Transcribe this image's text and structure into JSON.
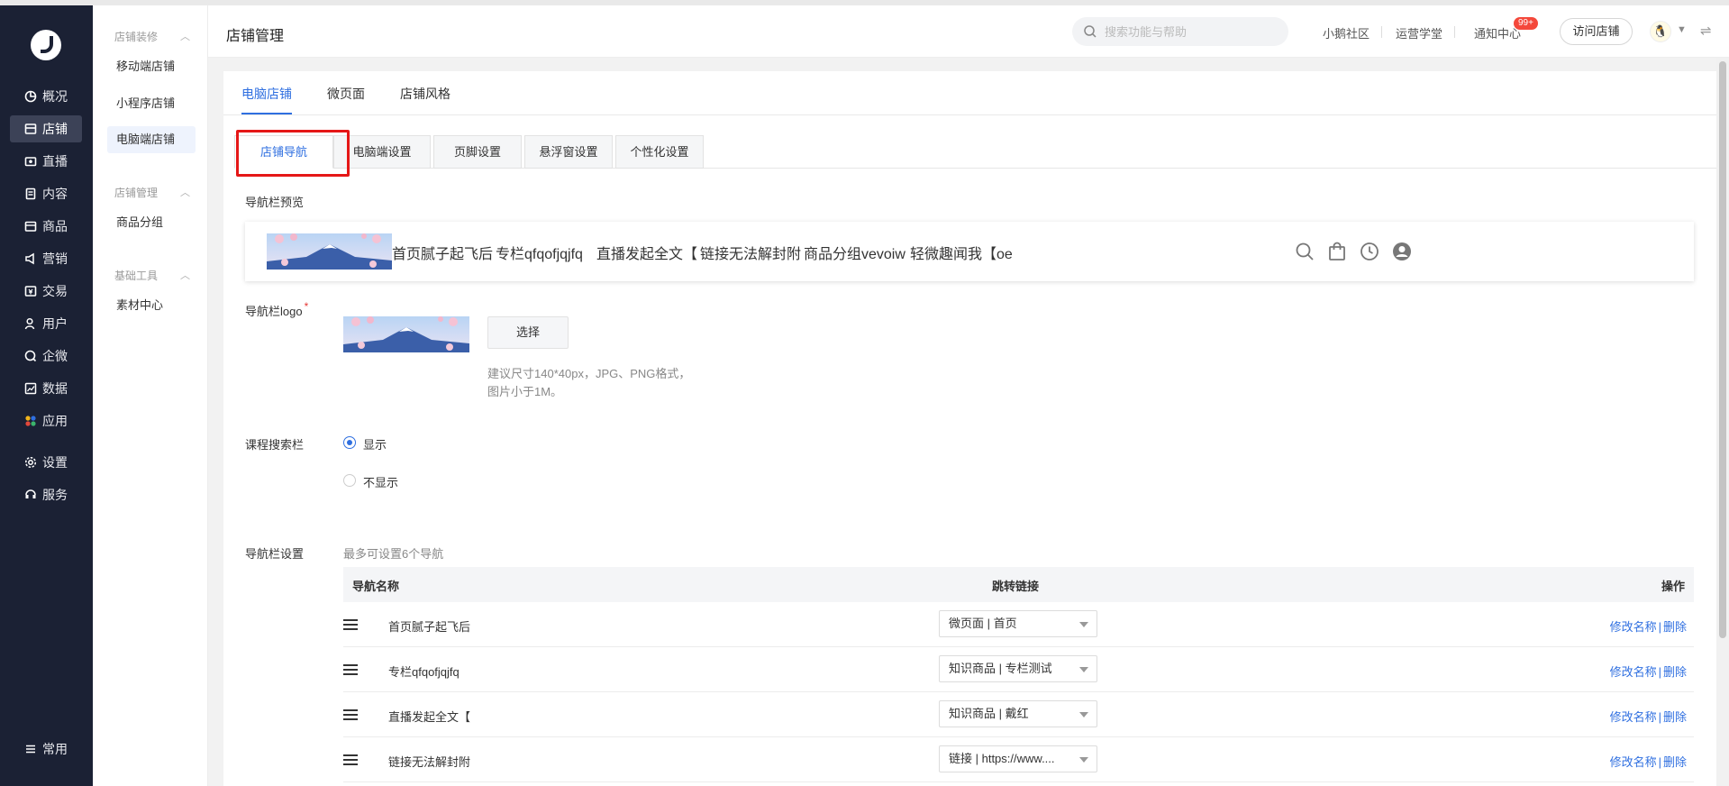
{
  "left_nav": {
    "items": [
      {
        "label": "概况",
        "icon": "pie-chart-icon"
      },
      {
        "label": "店铺",
        "icon": "store-icon",
        "active": true
      },
      {
        "label": "直播",
        "icon": "live-icon"
      },
      {
        "label": "内容",
        "icon": "document-icon"
      },
      {
        "label": "商品",
        "icon": "box-icon"
      },
      {
        "label": "营销",
        "icon": "megaphone-icon"
      },
      {
        "label": "交易",
        "icon": "wallet-icon"
      },
      {
        "label": "用户",
        "icon": "user-icon"
      },
      {
        "label": "企微",
        "icon": "chat-icon"
      },
      {
        "label": "数据",
        "icon": "chart-icon"
      },
      {
        "label": "应用",
        "icon": "apps-icon"
      },
      {
        "label": "设置",
        "icon": "gear-icon"
      },
      {
        "label": "服务",
        "icon": "service-icon"
      }
    ],
    "bottom": {
      "label": "常用",
      "icon": "list-icon"
    }
  },
  "sub_nav": {
    "groups": [
      {
        "title": "店铺装修",
        "items": [
          "移动端店铺",
          "小程序店铺",
          "电脑端店铺"
        ],
        "active": "电脑端店铺"
      },
      {
        "title": "店铺管理",
        "items": [
          "商品分组"
        ]
      },
      {
        "title": "基础工具",
        "items": [
          "素材中心"
        ]
      }
    ]
  },
  "header": {
    "title": "店铺管理",
    "search_placeholder": "搜索功能与帮助",
    "links": [
      "小鹅社区",
      "运营学堂",
      "通知中心"
    ],
    "badge": "99+",
    "visit_button": "访问店铺"
  },
  "tabs": [
    "电脑店铺",
    "微页面",
    "店铺风格"
  ],
  "sub_tabs": [
    "店铺导航",
    "电脑端设置",
    "页脚设置",
    "悬浮窗设置",
    "个性化设置"
  ],
  "form": {
    "preview_label": "导航栏预览",
    "preview_nav": [
      "首页腻子起飞后",
      "专栏qfqofjqjfq",
      "直播发起全文【",
      "链接无法解封附",
      "商品分组vevoiw",
      "轻微趣闻我【oe"
    ],
    "logo_label": "导航栏logo",
    "required_mark": "*",
    "select_button": "选择",
    "logo_hint_1": "建议尺寸140*40px，JPG、PNG格式，",
    "logo_hint_2": "图片小于1M。",
    "search_bar_label": "课程搜索栏",
    "radio_show": "显示",
    "radio_hide": "不显示",
    "radio_selected": "显示",
    "nav_settings_label": "导航栏设置",
    "nav_settings_hint": "最多可设置6个导航"
  },
  "table": {
    "headers": [
      "导航名称",
      "跳转链接",
      "操作"
    ],
    "rows": [
      {
        "name": "首页腻子起飞后",
        "link": "微页面 | 首页"
      },
      {
        "name": "专栏qfqofjqjfq",
        "link": "知识商品 | 专栏测试"
      },
      {
        "name": "直播发起全文【",
        "link": "知识商品 | 戴红"
      },
      {
        "name": "链接无法解封附",
        "link": "链接 | https://www...."
      }
    ],
    "op_rename": "修改名称",
    "op_sep": "|",
    "op_delete": "删除"
  },
  "colors": {
    "accent": "#2f6fe0",
    "sidebar": "#1b2134",
    "highlight": "#e51717"
  }
}
